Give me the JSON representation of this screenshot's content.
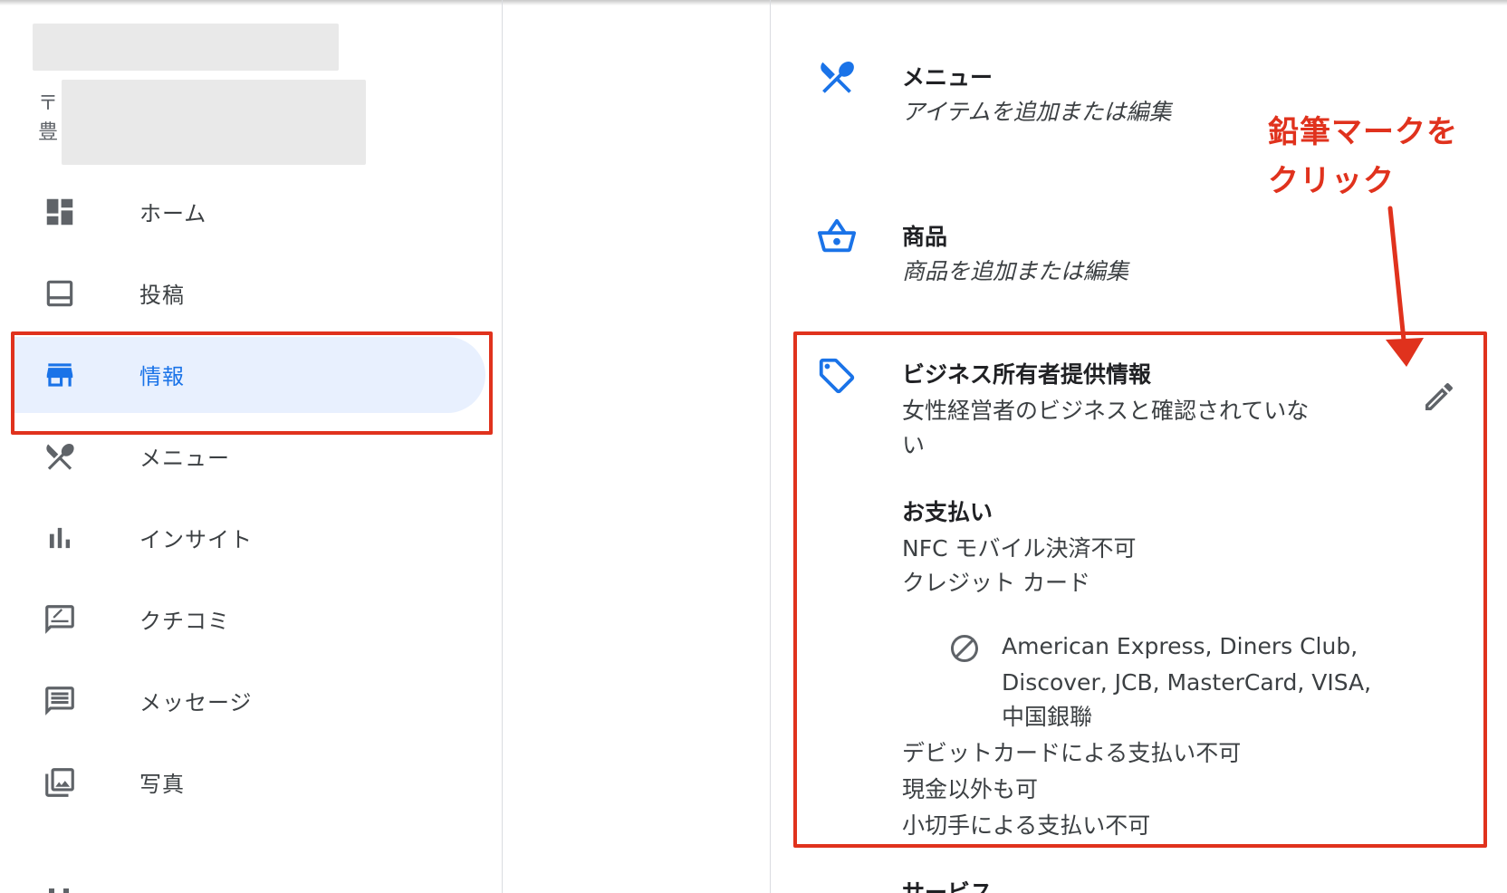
{
  "sidebar": {
    "address_chars": [
      "〒",
      "豊"
    ],
    "items": [
      {
        "label": "ホーム",
        "icon": "dashboard-icon"
      },
      {
        "label": "投稿",
        "icon": "posts-icon"
      },
      {
        "label": "情報",
        "icon": "storefront-icon"
      },
      {
        "label": "メニュー",
        "icon": "restaurant-menu-icon"
      },
      {
        "label": "インサイト",
        "icon": "bar-chart-icon"
      },
      {
        "label": "クチコミ",
        "icon": "rate-review-icon"
      },
      {
        "label": "メッセージ",
        "icon": "message-icon"
      },
      {
        "label": "写真",
        "icon": "photo-library-icon"
      }
    ]
  },
  "panel": {
    "menu": {
      "title": "メニュー",
      "subtitle": "アイテムを追加または編集"
    },
    "products": {
      "title": "商品",
      "subtitle": "商品を追加または編集"
    },
    "owner_info": {
      "title": "ビジネス所有者提供情報",
      "line1": "女性経営者のビジネスと確認されていな",
      "line2": "い"
    },
    "payments": {
      "title": "お支払い",
      "nfc": "NFC モバイル決済不可",
      "credit": "クレジット カード",
      "cards_line1": "American Express, Diners Club,",
      "cards_line2": "Discover, JCB, MasterCard, VISA,",
      "cards_line3": "中国銀聯",
      "debit": "デビットカードによる支払い不可",
      "cashless": "現金以外も可",
      "check": "小切手による支払い不可"
    },
    "next_section_partial": "サービス"
  },
  "annotation": {
    "line1": "鉛筆マークを",
    "line2": "クリック"
  },
  "colors": {
    "accent": "#1a73e8",
    "active_bg": "#e8f0fe",
    "annotation_red": "#e0321d",
    "icon_gray": "#5f6368"
  }
}
